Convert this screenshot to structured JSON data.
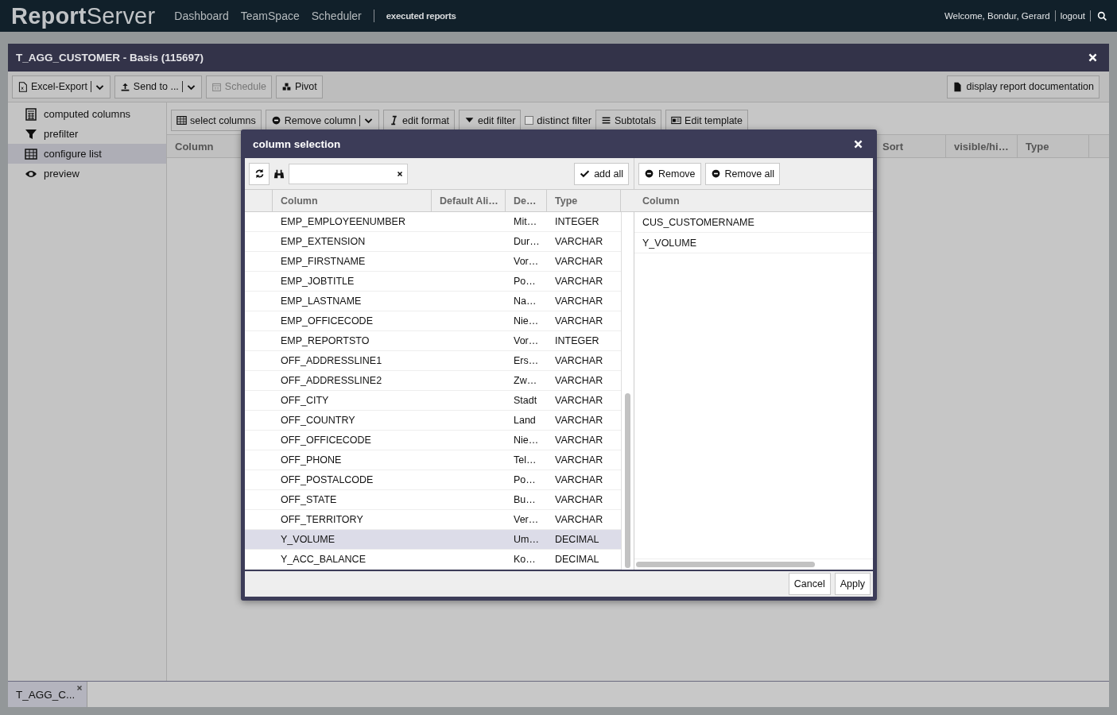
{
  "top_bar": {
    "logo": "**Report**Server",
    "nav": [
      {
        "label": "Dashboard"
      },
      {
        "label": "TeamSpace"
      },
      {
        "label": "Scheduler"
      }
    ],
    "executed": "executed reports",
    "welcome": "Welcome, Bondur, Gerard",
    "logout": "logout"
  },
  "report": {
    "title": "T_AGG_CUSTOMER - Basis (115697)",
    "toolbar": [
      {
        "label": "Excel-Export",
        "kind": "split",
        "disabled": false
      },
      {
        "label": "Send to ...",
        "kind": "split",
        "disabled": false
      },
      {
        "label": "Schedule",
        "kind": "plain",
        "disabled": true
      },
      {
        "label": "Pivot",
        "kind": "plain",
        "disabled": false
      }
    ],
    "doc_button": "display report documentation"
  },
  "sidebar": {
    "items": [
      {
        "label": "computed columns",
        "selected": false
      },
      {
        "label": "prefilter",
        "selected": false
      },
      {
        "label": "configure list",
        "selected": true
      },
      {
        "label": "preview",
        "selected": false
      }
    ]
  },
  "list_toolbar": [
    {
      "label": "select columns",
      "kind": "plain"
    },
    {
      "label": "Remove column",
      "kind": "split"
    },
    {
      "label": "edit format",
      "kind": "plain"
    },
    {
      "label": "edit filter",
      "kind": "plain"
    },
    {
      "label": "distinct filter",
      "kind": "checkbox",
      "checked": false
    },
    {
      "label": "Subtotals",
      "kind": "plain"
    },
    {
      "label": "Edit template",
      "kind": "plain"
    }
  ],
  "grid_columns": [
    "Column",
    "Sort",
    "visible/hi…",
    "Type"
  ],
  "dialog": {
    "title": "column selection",
    "add_all": "add all",
    "remove": "Remove",
    "remove_all": "Remove all",
    "available": {
      "columns": [
        "Column",
        "Default Ali…",
        "De…",
        "Type"
      ],
      "rows": [
        {
          "column": "EMP_EMPLOYEENUMBER",
          "description": "Mit…",
          "type": "INTEGER",
          "selected": false
        },
        {
          "column": "EMP_EXTENSION",
          "description": "Dur…",
          "type": "VARCHAR",
          "selected": false
        },
        {
          "column": "EMP_FIRSTNAME",
          "description": "Vor…",
          "type": "VARCHAR",
          "selected": false
        },
        {
          "column": "EMP_JOBTITLE",
          "description": "Po…",
          "type": "VARCHAR",
          "selected": false
        },
        {
          "column": "EMP_LASTNAME",
          "description": "Na…",
          "type": "VARCHAR",
          "selected": false
        },
        {
          "column": "EMP_OFFICECODE",
          "description": "Nie…",
          "type": "VARCHAR",
          "selected": false
        },
        {
          "column": "EMP_REPORTSTO",
          "description": "Vor…",
          "type": "INTEGER",
          "selected": false
        },
        {
          "column": "OFF_ADDRESSLINE1",
          "description": "Ers…",
          "type": "VARCHAR",
          "selected": false
        },
        {
          "column": "OFF_ADDRESSLINE2",
          "description": "Zw…",
          "type": "VARCHAR",
          "selected": false
        },
        {
          "column": "OFF_CITY",
          "description": "Stadt",
          "type": "VARCHAR",
          "selected": false
        },
        {
          "column": "OFF_COUNTRY",
          "description": "Land",
          "type": "VARCHAR",
          "selected": false
        },
        {
          "column": "OFF_OFFICECODE",
          "description": "Nie…",
          "type": "VARCHAR",
          "selected": false
        },
        {
          "column": "OFF_PHONE",
          "description": "Tel…",
          "type": "VARCHAR",
          "selected": false
        },
        {
          "column": "OFF_POSTALCODE",
          "description": "Po…",
          "type": "VARCHAR",
          "selected": false
        },
        {
          "column": "OFF_STATE",
          "description": "Bu…",
          "type": "VARCHAR",
          "selected": false
        },
        {
          "column": "OFF_TERRITORY",
          "description": "Ver…",
          "type": "VARCHAR",
          "selected": false
        },
        {
          "column": "Y_VOLUME",
          "description": "Um…",
          "type": "DECIMAL",
          "selected": true
        },
        {
          "column": "Y_ACC_BALANCE",
          "description": "Ko…",
          "type": "DECIMAL",
          "selected": false
        }
      ]
    },
    "chosen": {
      "column": "Column",
      "rows": [
        "CUS_CUSTOMERNAME",
        "Y_VOLUME"
      ]
    },
    "buttons": [
      "Cancel",
      "Apply"
    ]
  },
  "tabs": [
    {
      "label": "T_AGG_C...",
      "selected": true
    }
  ]
}
